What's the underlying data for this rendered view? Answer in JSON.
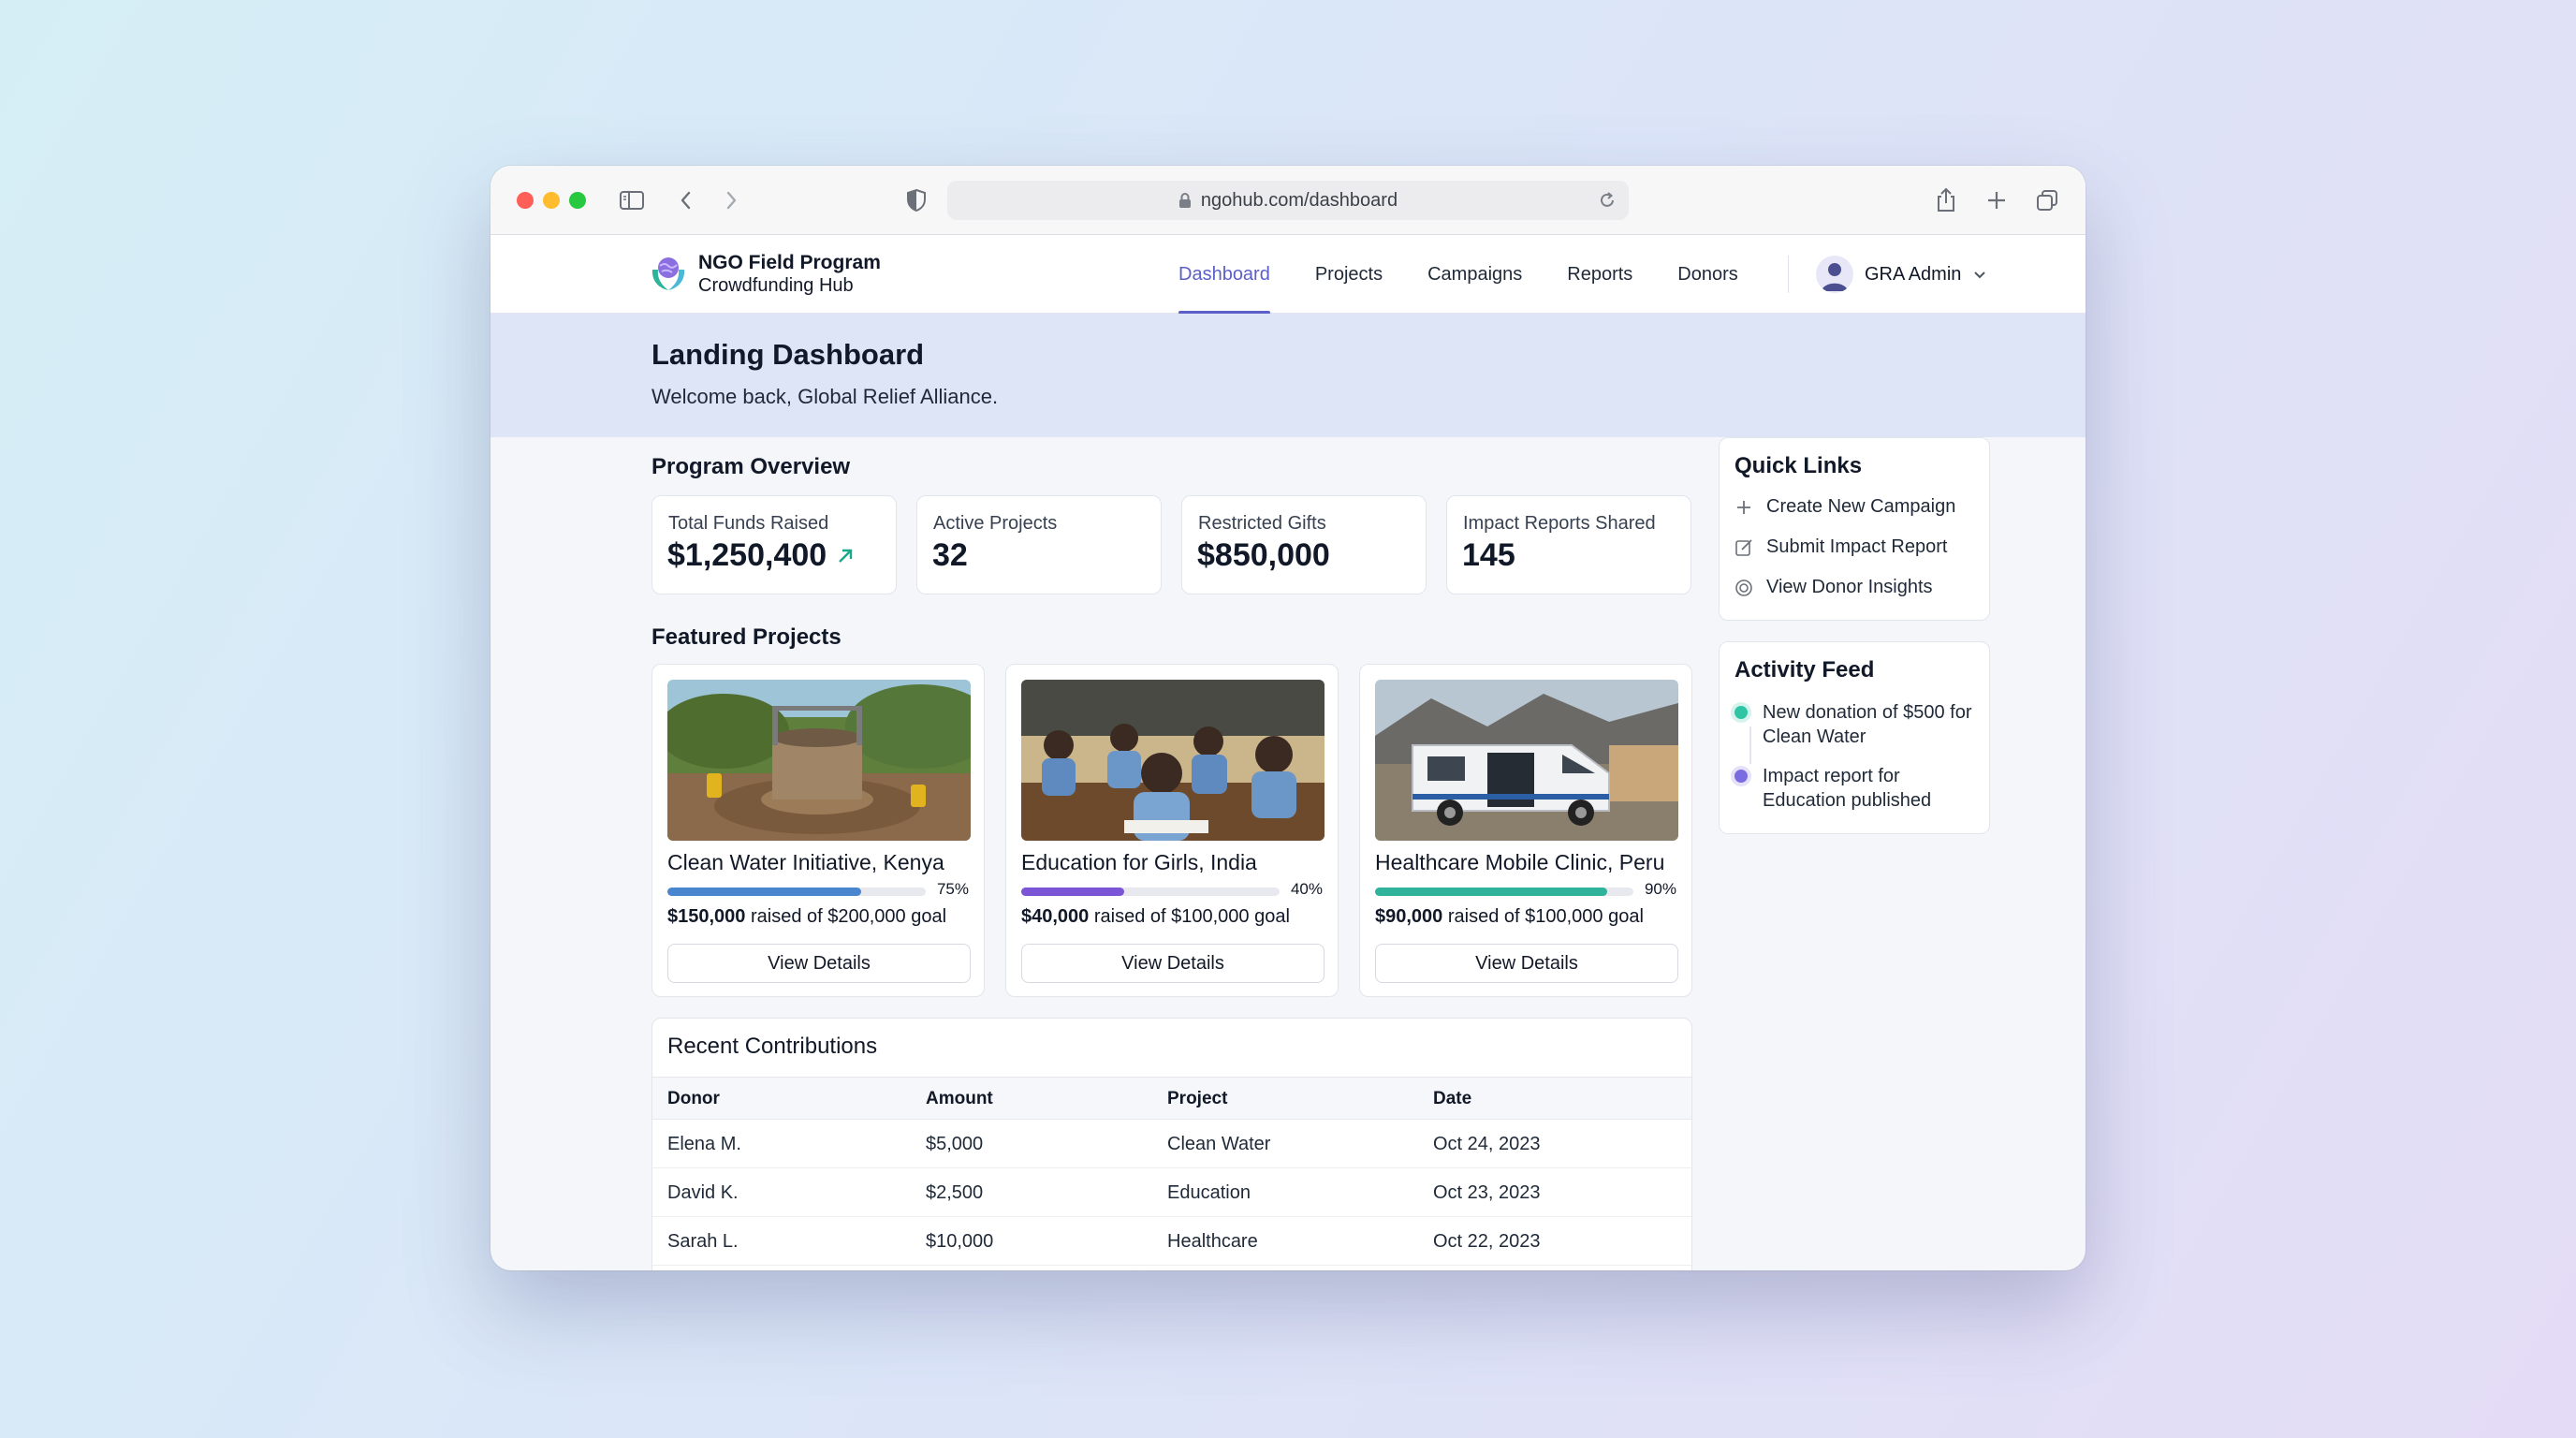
{
  "browser": {
    "url": "ngohub.com/dashboard"
  },
  "brand": {
    "name": "NGO Field Program",
    "subtitle": "Crowdfunding Hub"
  },
  "nav": {
    "links": [
      "Dashboard",
      "Projects",
      "Campaigns",
      "Reports",
      "Donors"
    ],
    "active": "Dashboard",
    "user_label": "GRA Admin"
  },
  "hero": {
    "title": "Landing Dashboard",
    "welcome": "Welcome back, Global Relief Alliance."
  },
  "overview": {
    "title": "Program Overview",
    "stats": [
      {
        "label": "Total Funds Raised",
        "value": "$1,250,400",
        "trend_icon": "arrow-up-right-icon"
      },
      {
        "label": "Active Projects",
        "value": "32"
      },
      {
        "label": "Restricted Gifts",
        "value": "$850,000"
      },
      {
        "label": "Impact Reports Shared",
        "value": "145"
      }
    ]
  },
  "featured": {
    "title": "Featured Projects",
    "projects": [
      {
        "title": "Clean Water Initiative, Kenya",
        "progress": 0.75,
        "progress_label": "75%",
        "raised": "$150,000",
        "raised_suffix": " raised of $200,000 goal",
        "color": "#4a86d0",
        "button": "View Details"
      },
      {
        "title": "Education for Girls, India",
        "progress": 0.4,
        "progress_label": "40%",
        "raised": "$40,000",
        "raised_suffix": " raised of $100,000 goal",
        "color": "#7a55d6",
        "button": "View Details"
      },
      {
        "title": "Healthcare Mobile Clinic, Peru",
        "progress": 0.9,
        "progress_label": "90%",
        "raised": "$90,000",
        "raised_suffix": " raised of $100,000 goal",
        "color": "#2fb39a",
        "button": "View Details"
      }
    ]
  },
  "contributions": {
    "title": "Recent Contributions",
    "columns": [
      "Donor",
      "Amount",
      "Project",
      "Date"
    ],
    "rows": [
      [
        "Elena M.",
        "$5,000",
        "Clean Water",
        "Oct 24, 2023"
      ],
      [
        "David K.",
        "$2,500",
        "Education",
        "Oct 23, 2023"
      ],
      [
        "Sarah L.",
        "$10,000",
        "Healthcare",
        "Oct 22, 2023"
      ]
    ]
  },
  "quick_links": {
    "title": "Quick Links",
    "items": [
      {
        "label": "Create New Campaign",
        "icon": "plus-icon"
      },
      {
        "label": "Submit Impact Report",
        "icon": "edit-icon"
      },
      {
        "label": "View Donor Insights",
        "icon": "insights-icon"
      }
    ]
  },
  "activity": {
    "title": "Activity Feed",
    "items": [
      {
        "text": "New donation of $500 for Clean Water",
        "color": "#2fc4a4"
      },
      {
        "text": "Impact report for Education published",
        "color": "#7b6be0"
      }
    ]
  }
}
